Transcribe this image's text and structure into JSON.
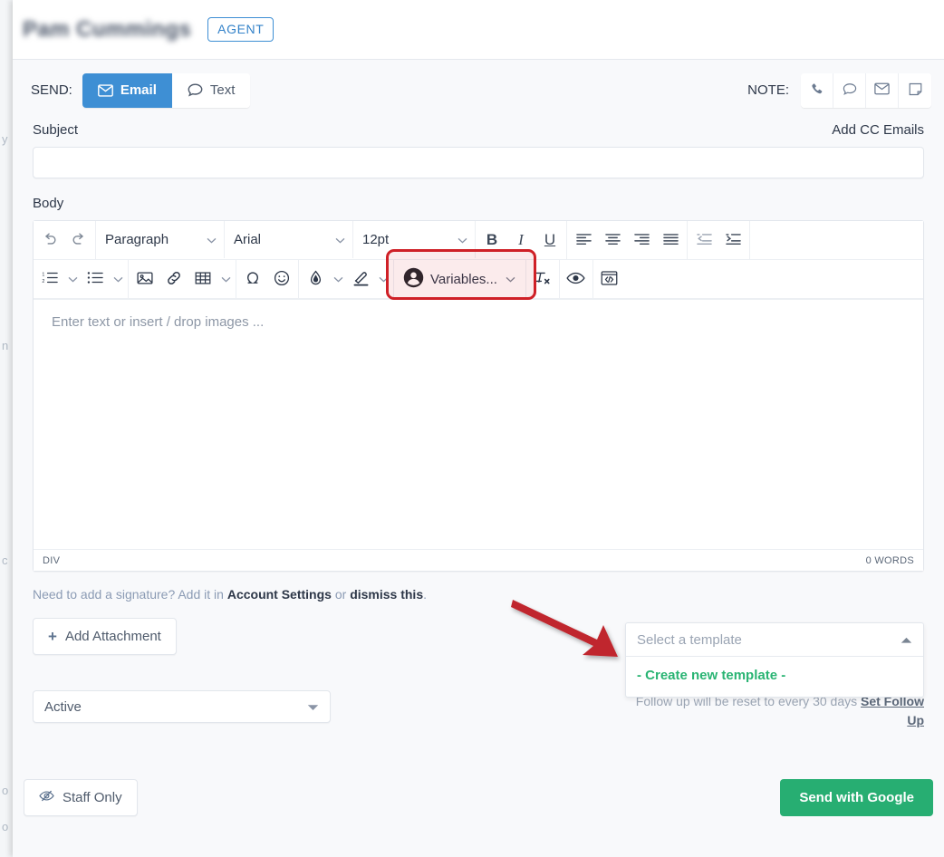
{
  "behind": {
    "ghosts": [
      "y",
      "n",
      "c",
      "o",
      "o"
    ]
  },
  "header": {
    "contact_name": "Pam Cummings",
    "badge": "AGENT"
  },
  "send_row": {
    "label": "SEND:",
    "options": [
      {
        "label": "Email",
        "icon": "envelope-icon",
        "active": true
      },
      {
        "label": "Text",
        "icon": "chat-bubble-icon",
        "active": false
      }
    ],
    "note_label": "NOTE:",
    "note_icons": [
      "phone-icon",
      "chat-bubble-icon",
      "envelope-icon",
      "sticky-note-icon"
    ]
  },
  "subject": {
    "label": "Subject",
    "add_cc": "Add CC Emails",
    "value": "",
    "placeholder": ""
  },
  "body": {
    "label": "Body",
    "editor_placeholder": "Enter text or insert / drop images ...",
    "status_element": "DIV",
    "word_count": "0 WORDS"
  },
  "toolbar": {
    "row1": {
      "undo": "undo-icon",
      "redo": "redo-icon",
      "block_format": "Paragraph",
      "font_family": "Arial",
      "font_size": "12pt",
      "bold": "B",
      "italic": "I",
      "underline": "U",
      "align": [
        "align-left-icon",
        "align-center-icon",
        "align-right-icon",
        "align-justify-icon"
      ],
      "indent": [
        "outdent-icon",
        "indent-icon"
      ]
    },
    "row2": {
      "numbered_list": "numbered-list-icon",
      "bullet_list": "bullet-list-icon",
      "image": "image-icon",
      "link": "link-icon",
      "table": "table-icon",
      "special_char": "omega-icon",
      "emoji": "emoji-icon",
      "text_color": "text-color-icon",
      "highlight": "highlighter-icon",
      "variables_label": "Variables...",
      "clear_format": "clear-formatting-icon",
      "preview": "preview-eye-icon",
      "source_code": "source-code-icon"
    }
  },
  "signature_note": {
    "prefix": "Need to add a signature? Add it in ",
    "link1": "Account Settings",
    "middle": " or ",
    "link2": "dismiss this",
    "suffix": "."
  },
  "attachment": {
    "label": "Add Attachment",
    "plus": "+"
  },
  "status_select": {
    "value": "Active"
  },
  "template": {
    "placeholder": "Select a template",
    "options": [
      "- Create new template -"
    ],
    "caret": "chevron-up-icon"
  },
  "followup": {
    "text": "Follow up will be reset to every 30 days ",
    "link": "Set Follow Up"
  },
  "footer": {
    "staff_only": "Staff Only",
    "send_button": "Send with Google"
  },
  "colors": {
    "accent_blue": "#3e8fd4",
    "send_green": "#27ae72",
    "template_green": "#29b473",
    "annotation_red": "#cf2027",
    "body_bg": "#f8f9fb"
  }
}
